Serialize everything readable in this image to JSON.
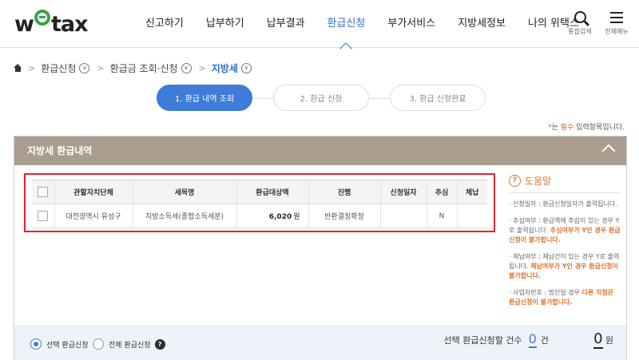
{
  "brand": {
    "logo_pre": "w",
    "logo_post": "tax"
  },
  "nav": {
    "items": [
      "신고하기",
      "납부하기",
      "납부결과",
      "환급신청",
      "부가서비스",
      "지방세정보",
      "나의 위택스"
    ],
    "active_index": 3,
    "search_label": "통합검색",
    "menu_label": "전체메뉴"
  },
  "breadcrumb": {
    "items": [
      "환급신청",
      "환급금 조회·신청",
      "지방세"
    ]
  },
  "steps": {
    "items": [
      "1. 환급 내역 조회",
      "2. 환급 신청",
      "3. 환급 신청완료"
    ],
    "active_index": 0
  },
  "required_note": {
    "star": "*",
    "text_a": "는 ",
    "mandatory": "필수",
    "text_b": " 입력항목입니다."
  },
  "panel": {
    "title": "지방세 환급내역"
  },
  "table": {
    "headers": [
      "관할자치단체",
      "세목명",
      "환급대상액",
      "진행",
      "신청일자",
      "추심",
      "체납"
    ],
    "rows": [
      {
        "authority": "대전광역시 유성구",
        "tax": "지방소득세(종합소득세분)",
        "amount": "6,020",
        "unit": "원",
        "status": "반환결정확정",
        "date": "",
        "collect": "N",
        "arrears": ""
      }
    ]
  },
  "help": {
    "title": "도움말",
    "items": [
      {
        "text": "신청일자 : 환급신청일자가 출력됩니다.",
        "warn": ""
      },
      {
        "text": "추심여부 : 환급액에 추심이 있는 경우 Y로 출력됩니다. ",
        "warn": "추심여부가 Y인 경우 환급신청이 불가합니다."
      },
      {
        "text": "체납여부 : 체납건이 있는 경우 Y로 출력됩니다. ",
        "warn": "체납여부가 Y인 경우 환급신청이 불가합니다."
      },
      {
        "text": "사업자번호 : 법인일 경우 ",
        "warn": "다른 지점은 환급신청이 불가합니다."
      }
    ]
  },
  "bottom": {
    "radio_selected": "선택 환급신청",
    "radio_all": "전체 환급신청",
    "count_label": "선택 환급신청할 건수",
    "count_value": "0",
    "count_unit": "건",
    "amount_value": "0",
    "amount_unit": "원"
  },
  "colors": {
    "accent": "#3f7bd8",
    "panel_header": "#a99d8e",
    "warn": "#e0722b",
    "highlight_border": "#e0242a"
  }
}
